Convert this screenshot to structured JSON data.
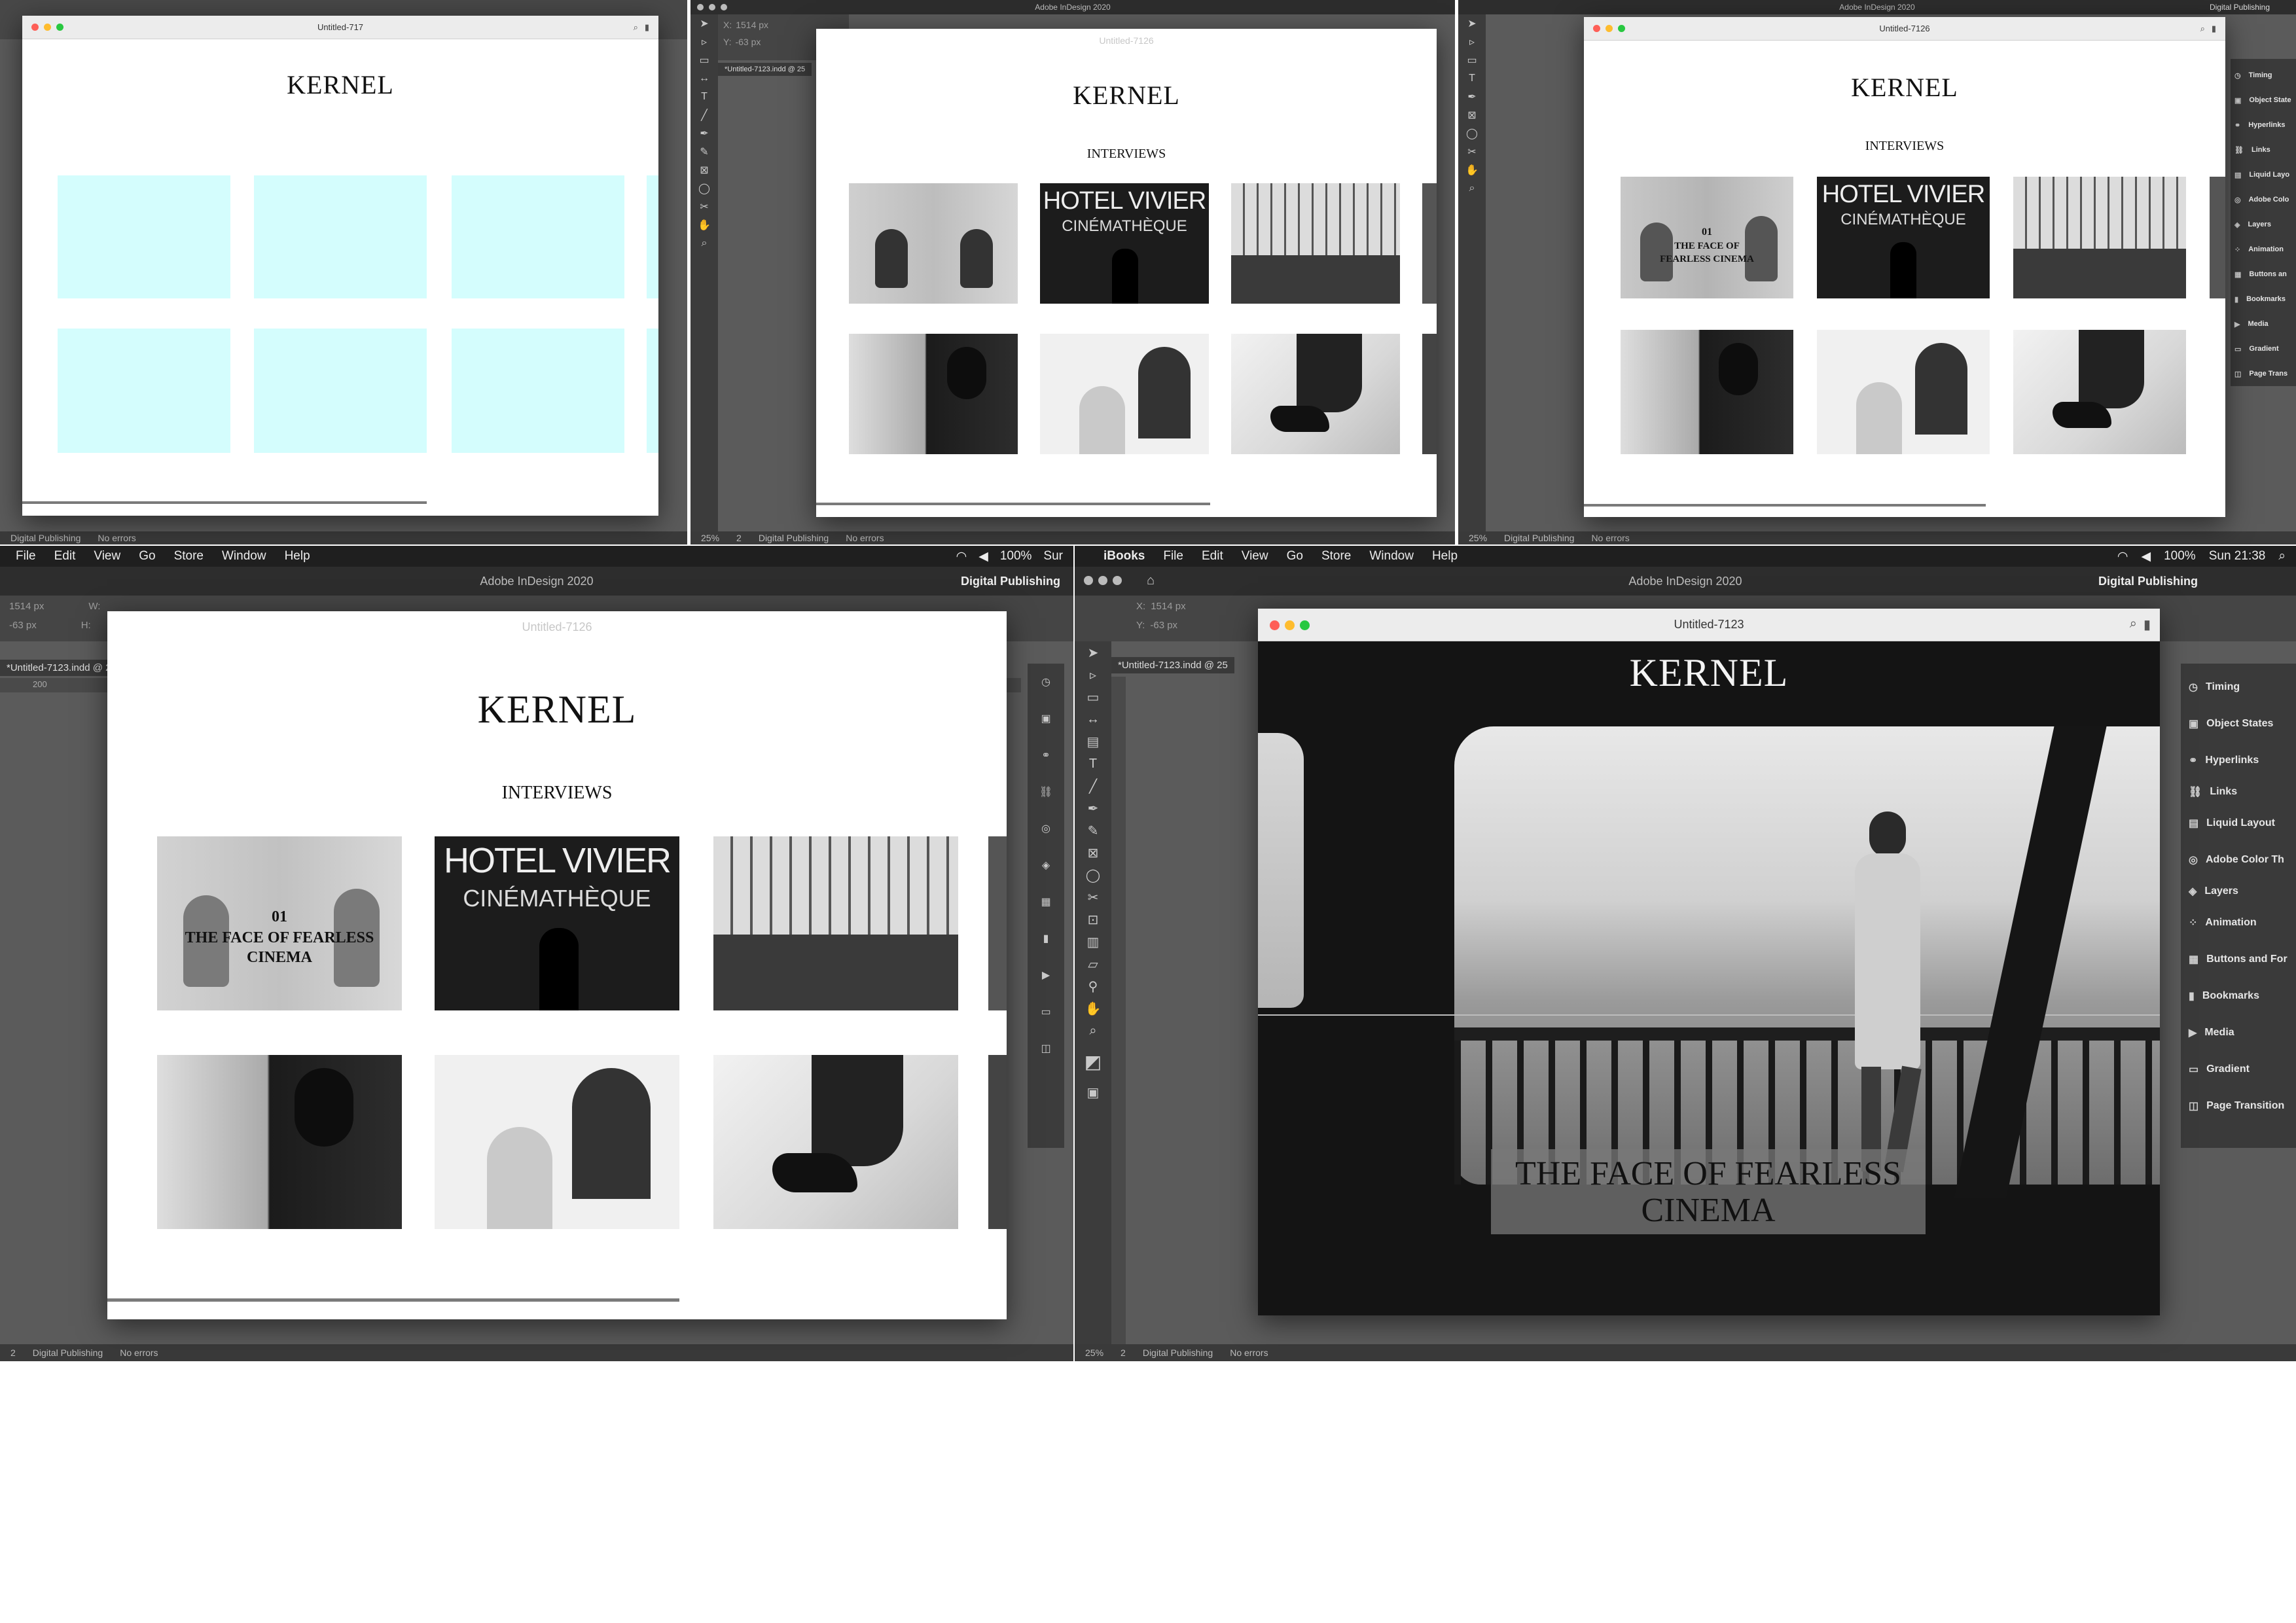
{
  "app": {
    "name": "Adobe InDesign 2020",
    "workspace": "Digital Publishing",
    "zoom": "25%",
    "page_number": "2",
    "errors": "No errors",
    "doc_tab": "*Untitled-7123.indd @ 25",
    "x_field": "1514 px",
    "y_field": "-63 px",
    "x_label": "X:",
    "y_label": "Y:",
    "w_label": "W:",
    "h_label": "H:",
    "ruler_mark": "200"
  },
  "menus": {
    "left": [
      "File",
      "Edit",
      "View",
      "Go",
      "Store",
      "Window",
      "Help"
    ],
    "right": [
      "iBooks",
      "File",
      "Edit",
      "View",
      "Go",
      "Store",
      "Window",
      "Help"
    ],
    "battery": "100%",
    "time": "Sun 21:38",
    "partial_clock": "Sur"
  },
  "panels": {
    "items": [
      "Timing",
      "Object States",
      "Hyperlinks",
      "Links",
      "Liquid Layout",
      "Adobe Color Th",
      "Layers",
      "Animation",
      "Buttons and For",
      "Bookmarks",
      "Media",
      "Gradient",
      "Page Transition"
    ],
    "small_items": [
      "Timing",
      "Object State",
      "Hyperlinks",
      "Links",
      "Liquid Layo",
      "Adobe Colo",
      "Layers",
      "Animation",
      "Buttons an",
      "Bookmarks",
      "Media",
      "Gradient",
      "Page Trans"
    ]
  },
  "windows": {
    "w1": {
      "title": "Untitled-717",
      "heading": "KERNEL"
    },
    "w2": {
      "title": "Untitled-7126",
      "heading": "KERNEL",
      "subheading": "INTERVIEWS"
    },
    "w3": {
      "title": "Untitled-7126",
      "heading": "KERNEL",
      "subheading": "INTERVIEWS",
      "overlay_num": "01",
      "overlay_text": "THE FACE OF FEARLESS CINEMA"
    },
    "w4": {
      "title": "Untitled-7126",
      "heading": "KERNEL",
      "subheading": "INTERVIEWS",
      "overlay_num": "01",
      "overlay_text": "THE FACE OF FEARLESS CINEMA"
    },
    "w5": {
      "title": "Untitled-7123",
      "heading": "KERNEL",
      "caption": "THE FACE OF FEARLESS CINEMA"
    }
  },
  "thumb_text": {
    "hotel": "HOTEL VIVIER",
    "cinema": "CINÉMATHÈQUE"
  },
  "colors": {
    "placeholder": "#d4fdfd",
    "pane_bg": "#5b5b5b",
    "panel_bg": "#3a3a3a",
    "close": "#fe5f57",
    "minimize": "#febc2e",
    "zoom": "#28c840"
  }
}
